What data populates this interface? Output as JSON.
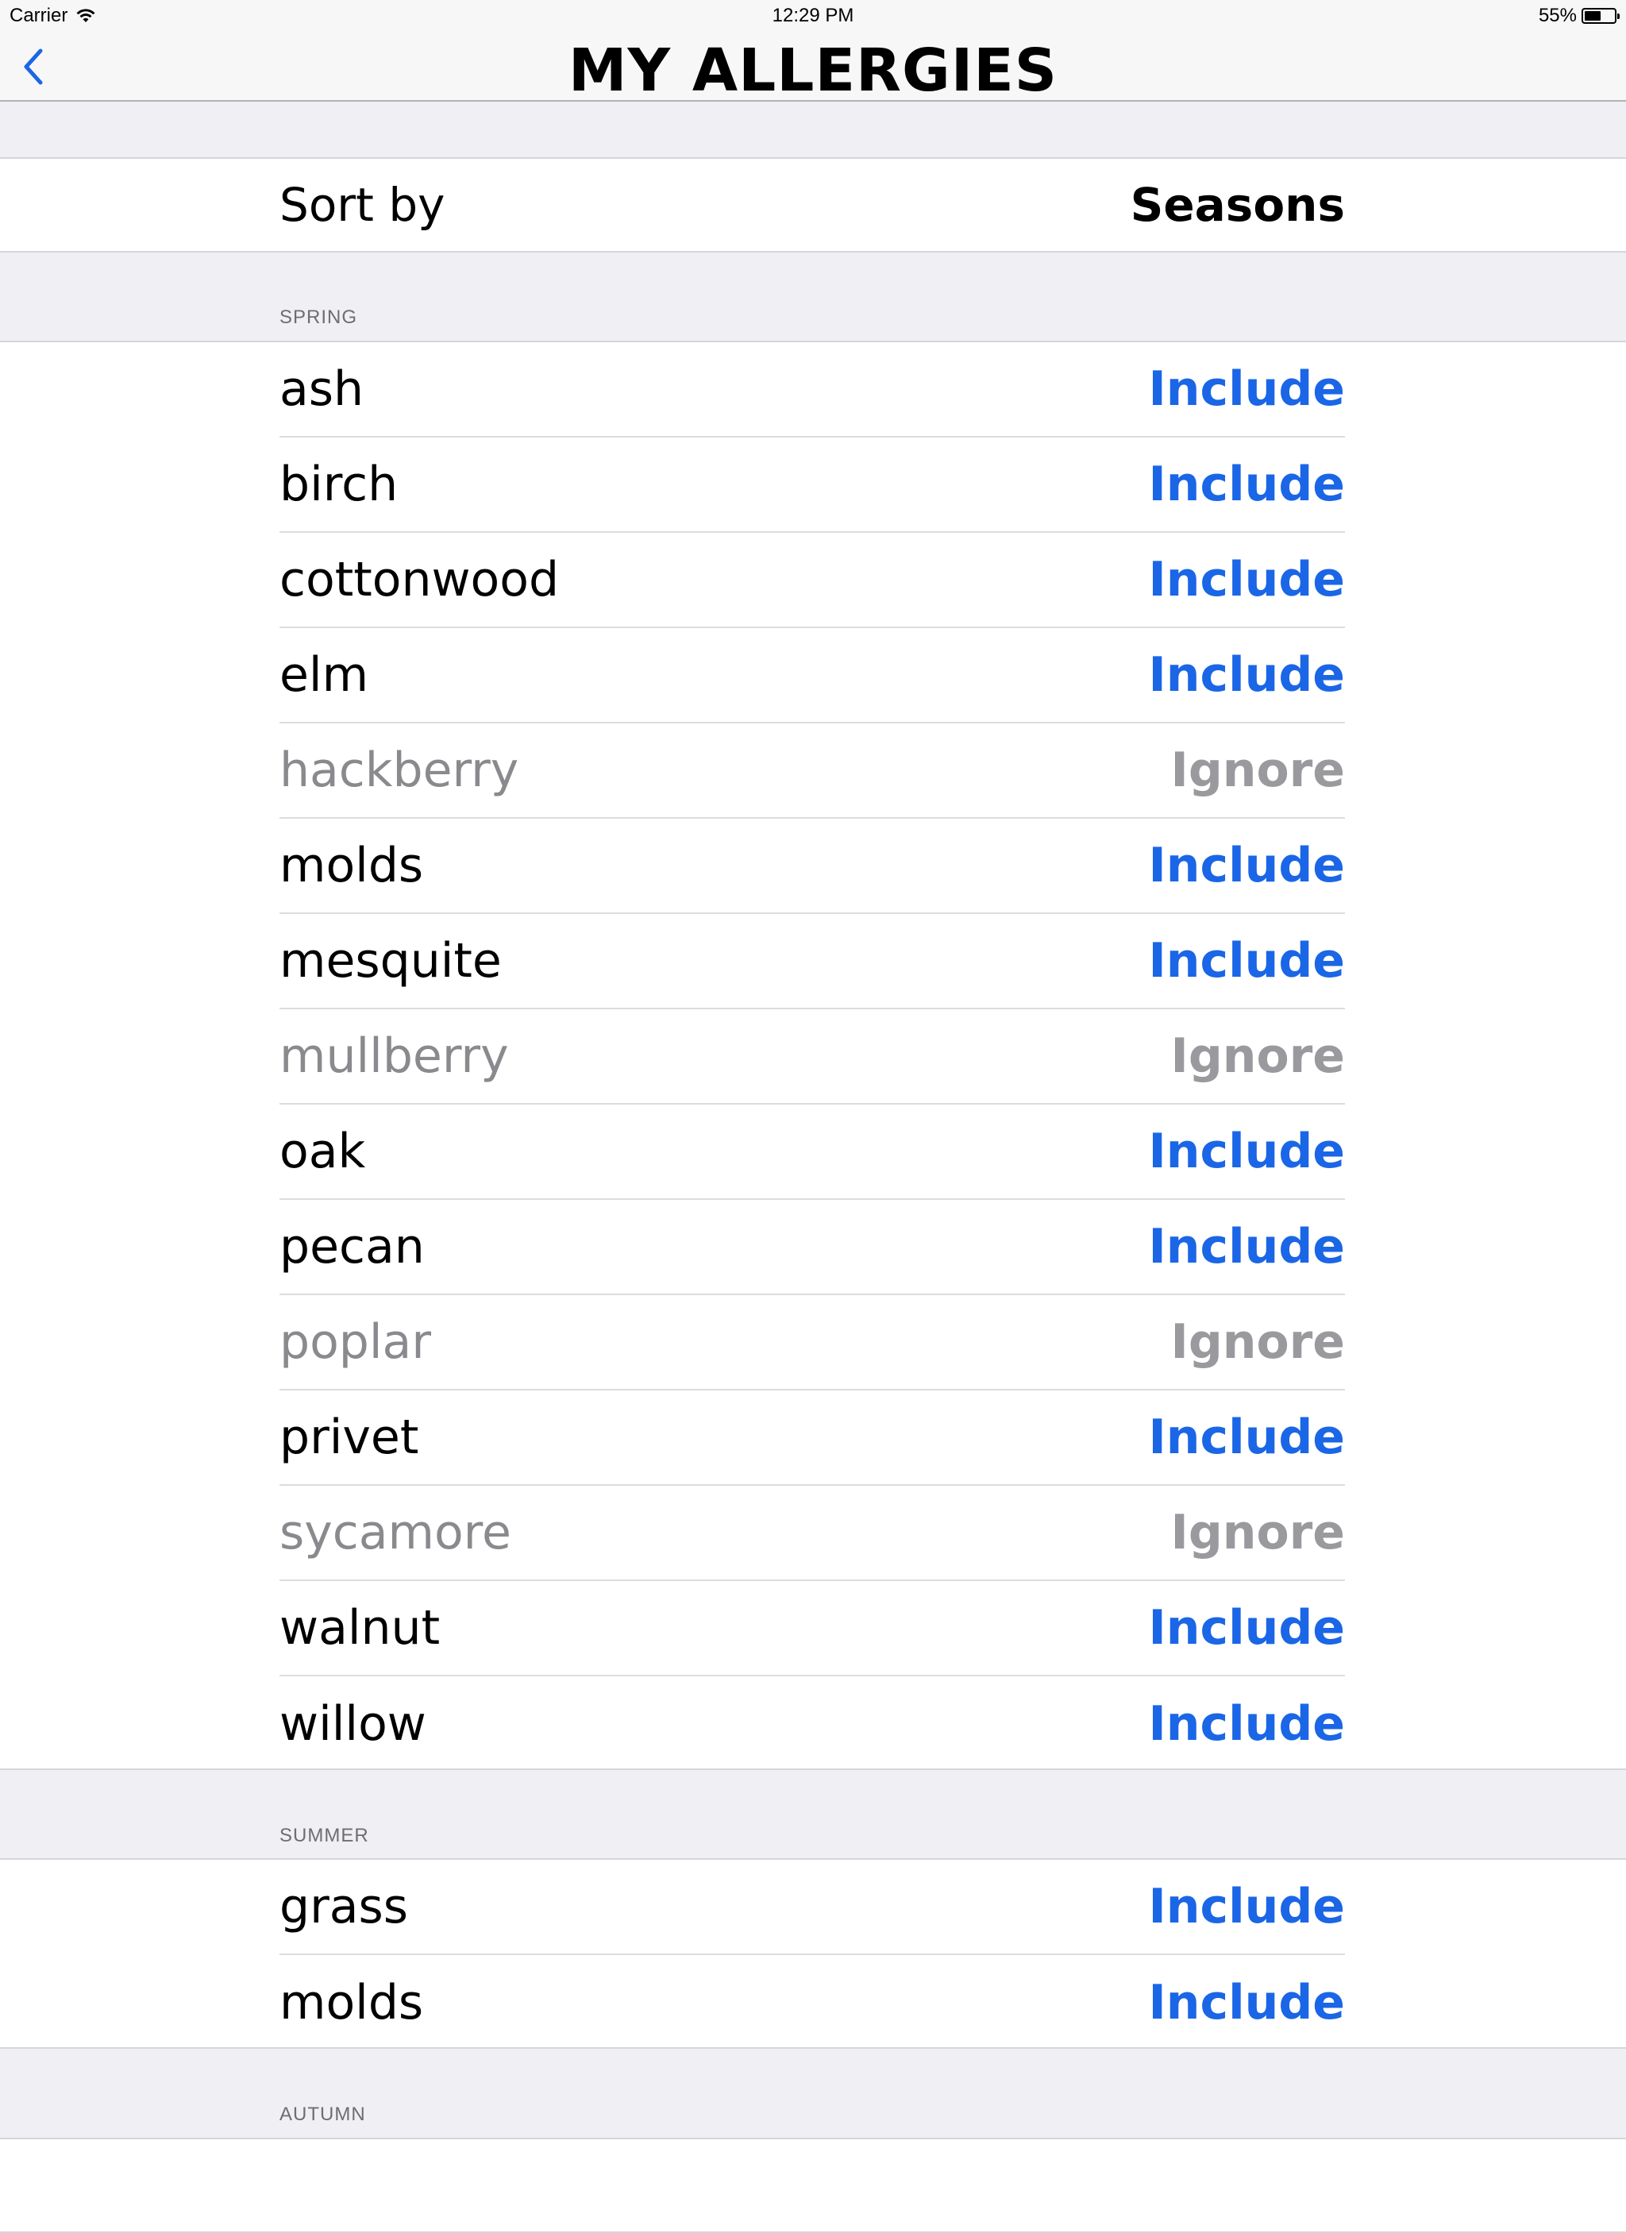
{
  "status_bar": {
    "carrier": "Carrier",
    "time": "12:29 PM",
    "battery": "55%",
    "battery_level": 0.55
  },
  "nav": {
    "title": "MY ALLERGIES",
    "back_icon": "chevron-left-icon"
  },
  "sort": {
    "label": "Sort by",
    "value": "Seasons"
  },
  "colors": {
    "accent": "#1a66e6",
    "ignored": "#9a9a9e",
    "background": "#efeff4"
  },
  "sections": [
    {
      "header": "SPRING",
      "items": [
        {
          "name": "ash",
          "status": "Include"
        },
        {
          "name": "birch",
          "status": "Include"
        },
        {
          "name": "cottonwood",
          "status": "Include"
        },
        {
          "name": "elm",
          "status": "Include"
        },
        {
          "name": "hackberry",
          "status": "Ignore"
        },
        {
          "name": "molds",
          "status": "Include"
        },
        {
          "name": "mesquite",
          "status": "Include"
        },
        {
          "name": "mullberry",
          "status": "Ignore"
        },
        {
          "name": "oak",
          "status": "Include"
        },
        {
          "name": "pecan",
          "status": "Include"
        },
        {
          "name": "poplar",
          "status": "Ignore"
        },
        {
          "name": "privet",
          "status": "Include"
        },
        {
          "name": "sycamore",
          "status": "Ignore"
        },
        {
          "name": "walnut",
          "status": "Include"
        },
        {
          "name": "willow",
          "status": "Include"
        }
      ]
    },
    {
      "header": "SUMMER",
      "items": [
        {
          "name": "grass",
          "status": "Include"
        },
        {
          "name": "molds",
          "status": "Include"
        }
      ]
    },
    {
      "header": "AUTUMN",
      "items": []
    }
  ]
}
